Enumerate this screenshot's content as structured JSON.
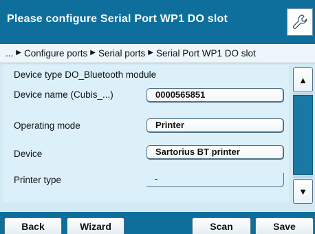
{
  "header": {
    "title": "Please configure Serial Port WP1 DO slot",
    "settings_icon": "wrench-icon"
  },
  "breadcrumb": {
    "leading": "...",
    "items": [
      "Configure ports",
      "Serial ports",
      "Serial Port WP1 DO slot"
    ]
  },
  "panel": {
    "device_type": "Device type DO_Bluetooth module",
    "fields": [
      {
        "label": "Device name (Cubis_...)",
        "value": "0000565851"
      },
      {
        "label": "Operating mode",
        "value": "Printer"
      },
      {
        "label": "Device",
        "value": "Sartorius BT printer"
      },
      {
        "label": "Printer type",
        "value": "-"
      }
    ]
  },
  "scrollbar": {
    "up_icon": "arrow-up-icon",
    "down_icon": "arrow-down-icon"
  },
  "softkeys": {
    "back": "Back",
    "wizard": "Wizard",
    "scan": "Scan",
    "save": "Save"
  },
  "colors": {
    "header_bg": "#0e6f9c",
    "panel_bg": "#dcf0fa",
    "scroll_thumb": "#1a78a4"
  }
}
